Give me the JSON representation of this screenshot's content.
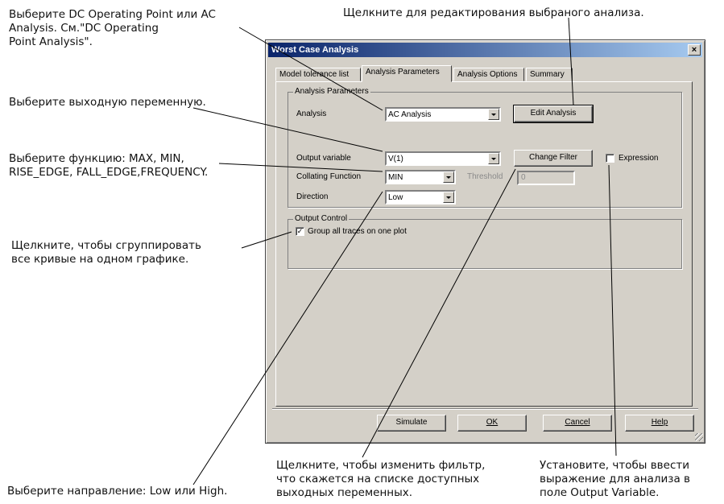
{
  "dialog": {
    "title": "Worst Case Analysis",
    "close_label": "×",
    "tabs": [
      {
        "label": "Model tolerance list"
      },
      {
        "label": "Analysis Parameters",
        "active": true
      },
      {
        "label": "Analysis Options"
      },
      {
        "label": "Summary"
      }
    ],
    "analysis_group": {
      "label": "Analysis Parameters",
      "analysis_label": "Analysis",
      "analysis_value": "AC Analysis",
      "edit_button": "Edit Analysis",
      "output_variable_label": "Output variable",
      "output_variable_value": "V(1)",
      "change_filter_button": "Change Filter",
      "expression_label": "Expression",
      "expression_checked": false,
      "collating_function_label": "Collating Function",
      "collating_function_value": "MIN",
      "threshold_label": "Threshold",
      "threshold_value": "0",
      "direction_label": "Direction",
      "direction_value": "Low"
    },
    "output_group": {
      "label": "Output Control",
      "group_traces_label": "Group all traces on one plot",
      "group_traces_checked": true,
      "check_mark": "✓"
    },
    "buttons": {
      "simulate": "Simulate",
      "ok": "OK",
      "cancel": "Cancel",
      "help": "Help"
    }
  },
  "callouts": {
    "choose_analysis": "Выберите DC Operating Point или AC\nAnalysis. См.\"DC Operating\nPoint Analysis\".",
    "edit_analysis": "Щелкните для редактирования выбраного анализа.",
    "output_variable": "Выберите выходную переменную.",
    "function": "Выберите функцию: MAX, MIN,\nRISE_EDGE, FALL_EDGE,FREQUENCY.",
    "group_traces": "Щелкните, чтобы сгруппировать\nвсе кривые на одном графике.",
    "direction": "Выберите направление: Low или High.",
    "change_filter": "Щелкните, чтобы изменить фильтр,\nчто скажется на списке доступных\nвыходных переменных.",
    "expression": "Установите, чтобы ввести\nвыражение для анализа в\nполе Output Variable."
  }
}
